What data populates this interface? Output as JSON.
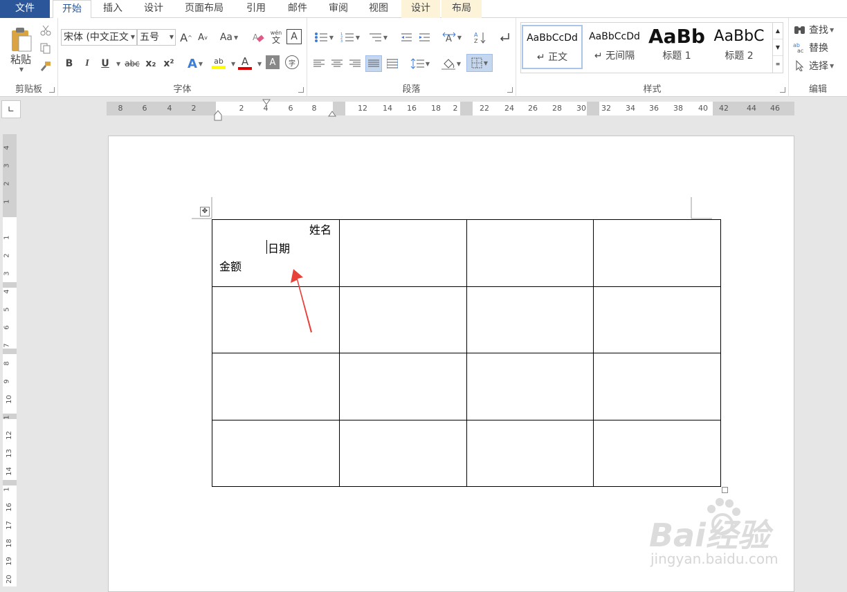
{
  "tabs": {
    "file": "文件",
    "home": "开始",
    "insert": "插入",
    "design": "设计",
    "layout": "页面布局",
    "references": "引用",
    "mailings": "邮件",
    "review": "审阅",
    "view": "视图",
    "table_design": "设计",
    "table_layout": "布局"
  },
  "clipboard": {
    "paste": "粘贴",
    "label": "剪贴板"
  },
  "font": {
    "name": "宋体 (中文正文",
    "size": "五号",
    "label": "字体",
    "change_case": "Aa",
    "phonetic_top": "wén",
    "phonetic_bottom": "文",
    "bold": "B",
    "italic": "I",
    "underline": "U",
    "strike": "abc",
    "subscript": "x₂",
    "superscript": "x²",
    "grow": "A",
    "shrink": "A",
    "font_color_letter": "A",
    "shading_letter": "A",
    "enclose_letter": "字",
    "highlight_letters": "ab"
  },
  "paragraph": {
    "label": "段落"
  },
  "styles": {
    "label": "样式",
    "items": [
      {
        "preview": "AaBbCcDd",
        "name": "↵ 正文"
      },
      {
        "preview": "AaBbCcDd",
        "name": "↵ 无间隔"
      },
      {
        "preview": "AaBb",
        "name": "标题 1"
      },
      {
        "preview": "AaBbC",
        "name": "标题 2"
      }
    ]
  },
  "editing": {
    "label": "编辑",
    "find": "查找",
    "replace": "替换",
    "select": "选择"
  },
  "ruler": {
    "corner": "∟",
    "h_ticks": [
      "8",
      "6",
      "4",
      "2",
      "2",
      "4",
      "6",
      "8",
      "12",
      "14",
      "16",
      "18",
      "2",
      "22",
      "24",
      "26",
      "28",
      "30",
      "32",
      "34",
      "36",
      "38",
      "40",
      "42",
      "44",
      "46"
    ],
    "v_ticks": [
      "4",
      "3",
      "2",
      "1",
      "1",
      "2",
      "3",
      "4",
      "5",
      "6",
      "7",
      "8",
      "9",
      "10",
      "1",
      "12",
      "13",
      "14",
      "1",
      "16",
      "17",
      "18",
      "19",
      "20"
    ]
  },
  "document": {
    "cell_text_1": "姓名",
    "cell_text_2": "日期",
    "cell_text_3": "金额"
  },
  "colors": {
    "accent": "#2b579a",
    "annotation_arrow": "#e8413a",
    "font_color_bar": "#e00000",
    "highlight_bar": "#ffff00"
  },
  "watermark": {
    "brand": "Bai经验",
    "url": "jingyan.baidu.com"
  }
}
